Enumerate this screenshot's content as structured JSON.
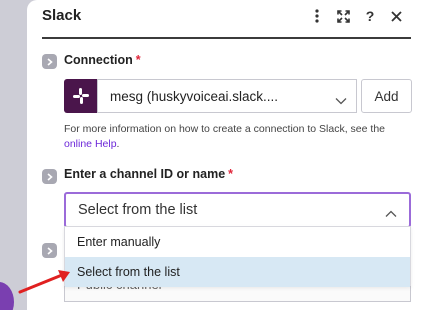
{
  "panel": {
    "title": "Slack",
    "header_icons": [
      "more-vertical-icon",
      "expand-icon",
      "help-icon",
      "close-icon"
    ],
    "help_label": "?"
  },
  "connection": {
    "label": "Connection",
    "required_mark": "*",
    "value": "mesg (huskyvoiceai.slack....",
    "add_label": "Add",
    "help_text_prefix": "For more information on how to create a connection to Slack, see the ",
    "help_link": "online Help",
    "help_text_suffix": "."
  },
  "channel": {
    "label": "Enter a channel ID or name",
    "required_mark": "*",
    "value": "Select from the list",
    "options": [
      "Enter manually",
      "Select from the list"
    ],
    "selected_index": 1
  },
  "underlying_field_value": "Public channel",
  "colors": {
    "accent": "#9b6bd9",
    "link": "#6d28d9",
    "required": "#e0263a",
    "selected_option": "#d7e8f4",
    "slack_purple": "#4a154b",
    "annotation_arrow": "#e02020"
  }
}
